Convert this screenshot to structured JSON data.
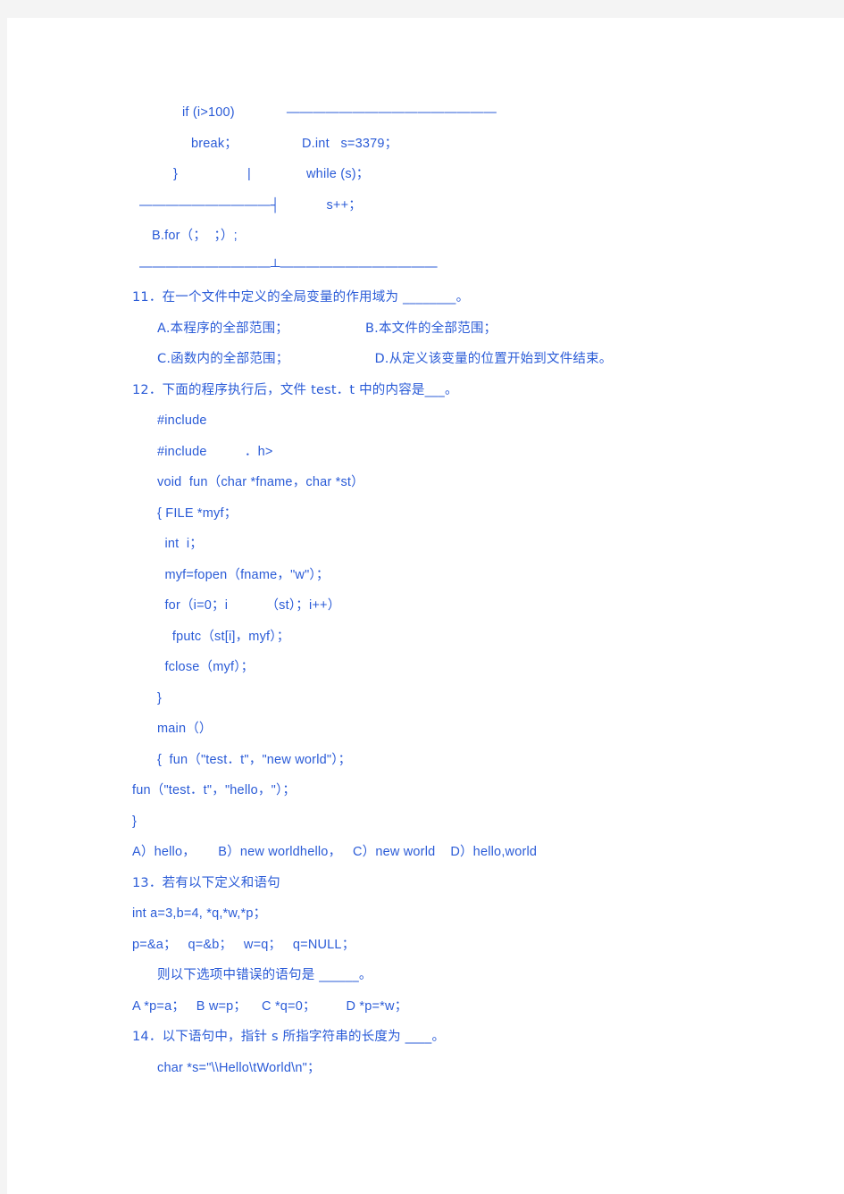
{
  "page": {
    "background_color": "#ffffff",
    "margin_color": "#f4f4f4",
    "text_color": "#2a5bd7"
  },
  "content": {
    "fragment_block": {
      "line1_code": "if (i>100)",
      "line1_rule": "————————————————",
      "line2_code": "break；",
      "line2_right": "D.int   s=3379；",
      "line3_code": "}",
      "line3_bar": "|",
      "line3_right": "while (s)；",
      "line4_rule": "——————————┤",
      "line4_right": "s++；",
      "line5_code": "B.for（；  ；）;",
      "line6_rule": "——————————┴————————————"
    },
    "q11": {
      "number": "11．",
      "stem": "在一个文件中定义的全局变量的作用域为 ________。",
      "options": [
        {
          "label": "A.本程序的全部范围；"
        },
        {
          "label": "B.本文件的全部范围；"
        },
        {
          "label": "C.函数内的全部范围；"
        },
        {
          "label": "D.从定义该变量的位置开始到文件结束。"
        }
      ]
    },
    "q12": {
      "number": "12．",
      "stem": "下面的程序执行后，文件 test．t 中的内容是___。",
      "code": [
        "#include",
        "#include          ．h>",
        "void  fun（char *fname，char *st）",
        "{ FILE *myf；",
        "  int  i；",
        "  myf=fopen（fname，\"w\"）；",
        "  for（i=0；i          （st）；i++）",
        "    fputc（st[i]，myf）；",
        "  fclose（myf）；",
        "}",
        "main（）",
        "{  fun（\"test．t\"，\"new world\"）；",
        "fun（\"test．t\"，\"hello，\"）；",
        "}"
      ],
      "options_line": "A）hello，      B）new worldhello，   C）new world    D）hello,world"
    },
    "q13": {
      "number": "13．",
      "stem": "若有以下定义和语句",
      "code": [
        "int a=3,b=4, *q,*w,*p；",
        "p=&a；   q=&b；   w=q；   q=NULL；"
      ],
      "prompt": "则以下选项中错误的语句是 ______。",
      "options_line": "A *p=a；   B w=p；    C *q=0；        D *p=*w；"
    },
    "q14": {
      "number": "14．",
      "stem": "以下语句中，指针 s 所指字符串的长度为 ____。",
      "code": "char *s=\"\\\\Hello\\tWorld\\n\"；"
    }
  }
}
